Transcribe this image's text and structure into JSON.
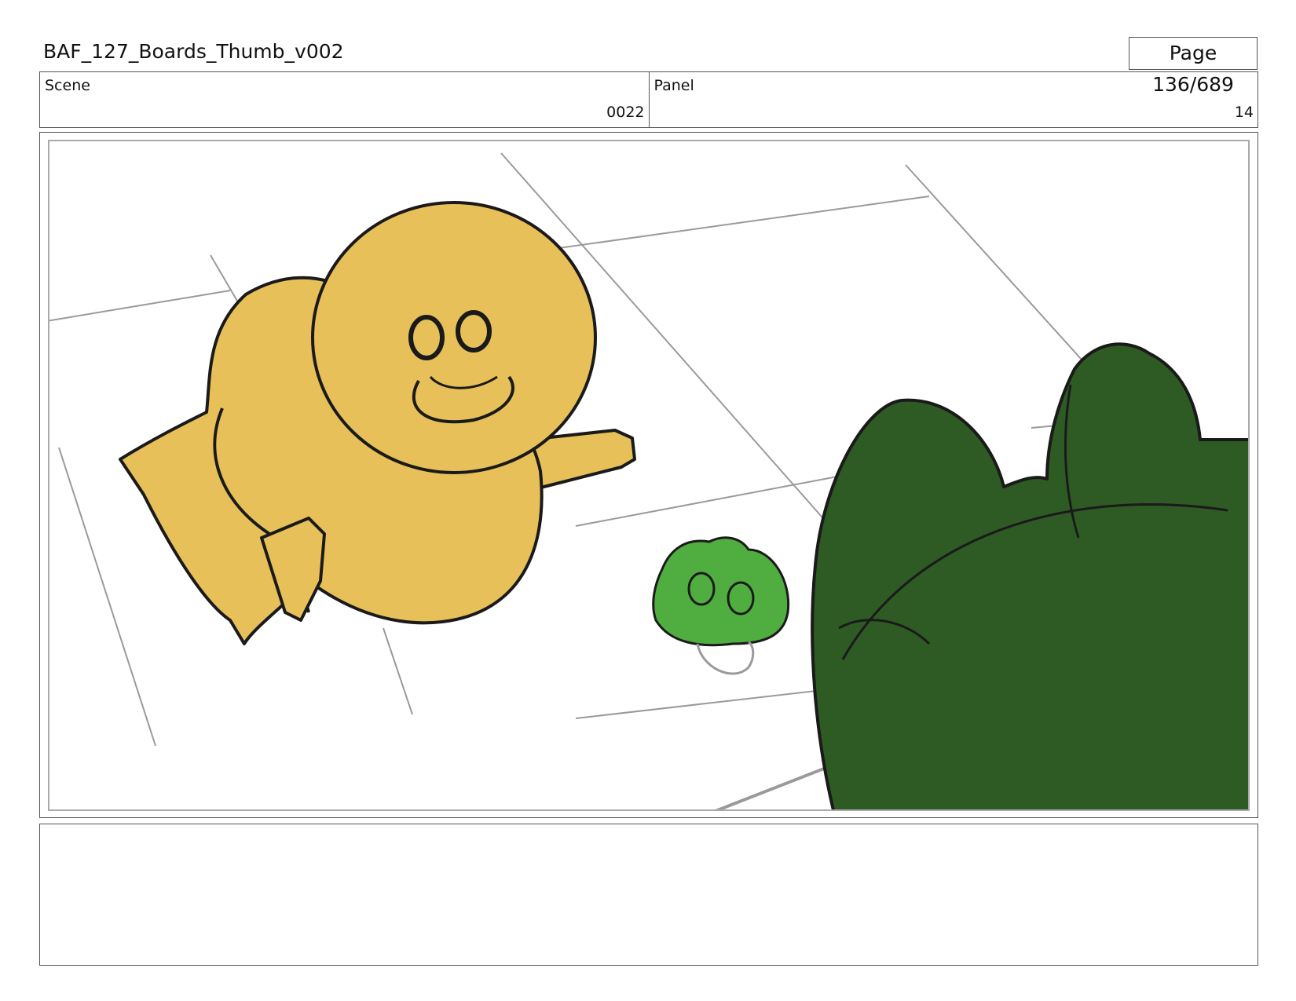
{
  "header": {
    "title": "BAF_127_Boards_Thumb_v002",
    "page": "Page 136/689"
  },
  "info": {
    "scene_label": "Scene",
    "scene_value": "0022",
    "panel_label": "Panel",
    "panel_value": "14"
  },
  "artwork": {
    "colors": {
      "yellow_character": "#e7c05a",
      "dark_green_character": "#2e5a24",
      "light_green_character": "#4fae3f",
      "pencil_line": "#9a9a9a",
      "ink_line": "#1a1a1a"
    }
  },
  "notes": {
    "text": ""
  }
}
